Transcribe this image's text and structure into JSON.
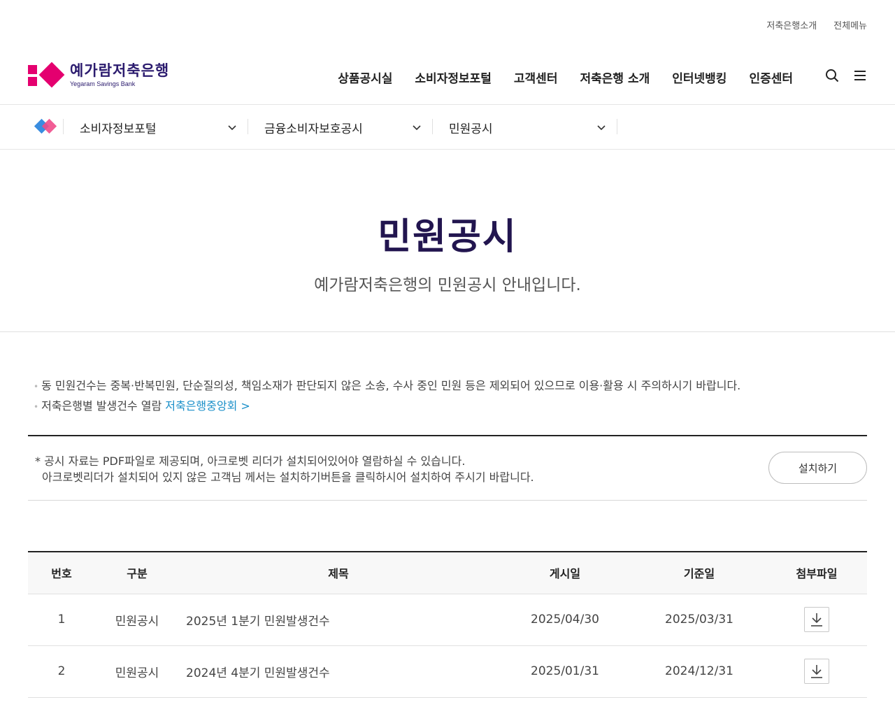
{
  "util": {
    "about": "저축은행소개",
    "allmenu": "전체메뉴"
  },
  "logo": {
    "ko": "예가람저축은행",
    "en": "Yegaram Savings Bank"
  },
  "gnb": [
    "상품공시실",
    "소비자정보포털",
    "고객센터",
    "저축은행 소개",
    "인터넷뱅킹",
    "인증센터"
  ],
  "subnav": [
    "소비자정보포털",
    "금융소비자보호공시",
    "민원공시"
  ],
  "page": {
    "title": "민원공시",
    "subtitle": "예가람저축은행의 민원공시 안내입니다."
  },
  "notes": {
    "line1": "동 민원건수는 중복·반복민원, 단순질의성, 책임소재가 판단되지 않은 소송, 수사 중인 민원 등은 제외되어 있으므로 이용·활용 시 주의하시기 바랍니다.",
    "line2_prefix": "저축은행별 발생건수 열람",
    "line2_link": "저축은행중앙회 >"
  },
  "pdf": {
    "line1": "* 공시 자료는 PDF파일로 제공되며, 아크로벳 리더가 설치되어있어야 열람하실 수 있습니다.",
    "line2": "아크로벳리더가 설치되어 있지 않은 고객님 께서는 설치하기버튼을 클릭하시어 설치하여 주시기 바랍니다.",
    "button": "설치하기"
  },
  "table": {
    "headers": [
      "번호",
      "구분",
      "제목",
      "게시일",
      "기준일",
      "첨부파일"
    ],
    "rows": [
      {
        "no": "1",
        "type": "민원공시",
        "title": "2025년 1분기 민원발생건수",
        "posted": "2025/04/30",
        "base": "2025/03/31"
      },
      {
        "no": "2",
        "type": "민원공시",
        "title": "2024년 4분기 민원발생건수",
        "posted": "2025/01/31",
        "base": "2024/12/31"
      }
    ]
  },
  "colors": {
    "brand": "#e4006f",
    "title": "#22154f",
    "link": "#1a8fc9"
  }
}
